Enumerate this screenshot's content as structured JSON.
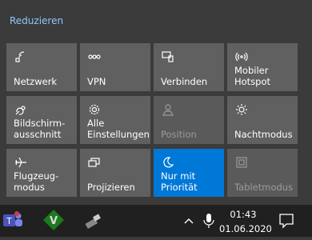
{
  "action_center": {
    "collapse_label": "Reduzieren",
    "tiles": [
      {
        "label": "Netzwerk",
        "icon": "network-icon",
        "state": "on"
      },
      {
        "label": "VPN",
        "icon": "vpn-icon",
        "state": "on"
      },
      {
        "label": "Verbinden",
        "icon": "connect-icon",
        "state": "on"
      },
      {
        "label": "Mobiler\nHotspot",
        "icon": "hotspot-icon",
        "state": "on"
      },
      {
        "label": "Bildschirm-\nausschnitt",
        "icon": "screen-snip-icon",
        "state": "on"
      },
      {
        "label": "Alle\nEinstellungen",
        "icon": "gear-icon",
        "state": "on"
      },
      {
        "label": "Position",
        "icon": "location-icon",
        "state": "disabled"
      },
      {
        "label": "Nachtmodus",
        "icon": "brightness-icon",
        "state": "on"
      },
      {
        "label": "Flugzeug-\nmodus",
        "icon": "airplane-icon",
        "state": "on"
      },
      {
        "label": "Projizieren",
        "icon": "project-icon",
        "state": "on"
      },
      {
        "label": "Nur mit\nPriorität",
        "icon": "moon-icon",
        "state": "active"
      },
      {
        "label": "Tabletmodus",
        "icon": "tablet-mode-icon",
        "state": "disabled"
      }
    ]
  },
  "taskbar": {
    "time": "01:43",
    "date": "01.06.2020",
    "apps": [
      "teams-icon",
      "vim-icon",
      "usb-icon"
    ],
    "tray": [
      "chevron-up-icon",
      "microphone-icon"
    ],
    "notification_icon": "notification-icon"
  },
  "colors": {
    "accent": "#0078d7",
    "tile": "#606060",
    "link": "#8fc7ff"
  }
}
